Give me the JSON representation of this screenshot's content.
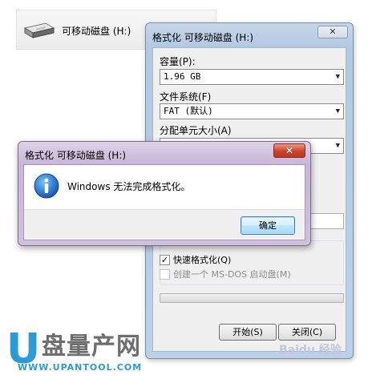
{
  "explorer": {
    "drive_label": "可移动磁盘 (H:)",
    "drive_icon": "removable-drive-icon"
  },
  "format_window": {
    "title": "格式化 可移动磁盘 (H:)",
    "close_glyph": "✕",
    "capacity_label": "容量(P):",
    "capacity_value": "1.96 GB",
    "filesystem_label": "文件系统(F)",
    "filesystem_value": "FAT (默认)",
    "allocation_label": "分配单元大小(A)",
    "quick_format_label": "快速格式化(Q)",
    "quick_format_checked": true,
    "msdos_label": "创建一个 MS-DOS 启动盘(M)",
    "msdos_checked": false,
    "progress": 0,
    "start_button": "开始(S)",
    "close_button": "关闭(C)"
  },
  "error_dialog": {
    "title": "格式化 可移动磁盘 (H:)",
    "close_glyph": "✕",
    "icon": "info-icon",
    "message": "Windows 无法完成格式化。",
    "ok_button": "确定"
  },
  "watermark": {
    "logo_letter": "U",
    "logo_text": "盘量产网",
    "logo_url": "WWW.UPANTOOL.COM",
    "baidu_text": "Baidu 经验"
  },
  "colors": {
    "format_frame": "#b3c8e2",
    "error_frame": "#c9b6da",
    "close_red": "#c9432a",
    "logo_blue": "#2a9ad8"
  }
}
